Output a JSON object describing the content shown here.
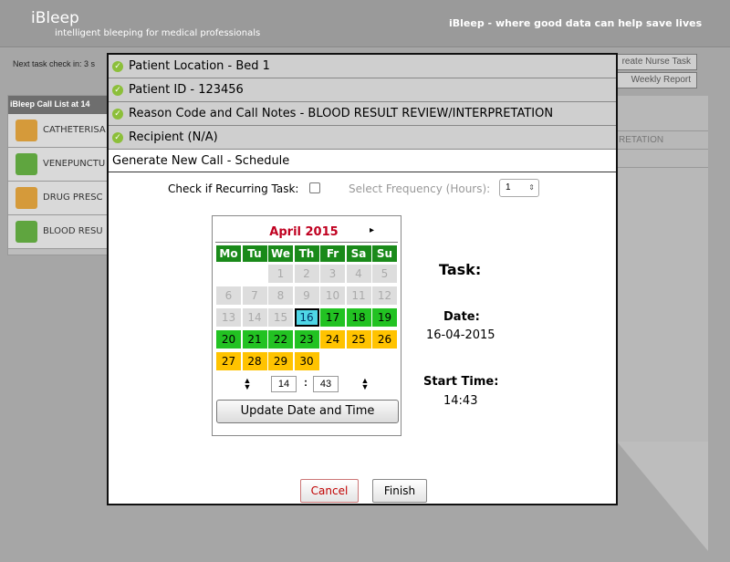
{
  "header": {
    "brand": "iBleep",
    "tagline": "intelligent bleeping for medical professionals",
    "slogan": "iBleep - where good data can help save lives"
  },
  "background": {
    "next_check": "Next task check in: 3 s",
    "create_nurse_task": "reate Nurse Task",
    "weekly_report": "Weekly Report",
    "call_list_title": "iBleep Call List at 14",
    "call_items": [
      {
        "label": "CATHETERISA",
        "icon": "rss-icon"
      },
      {
        "label": "VENEPUNCTU",
        "icon": "thumbs-up-icon"
      },
      {
        "label": "DRUG PRESC",
        "icon": "rss-icon"
      },
      {
        "label": "BLOOD RESU",
        "icon": "thumbs-up-icon"
      }
    ],
    "right_text": "RETATION"
  },
  "modal": {
    "accordion": [
      {
        "label": "Patient Location - Bed 1"
      },
      {
        "label": "Patient ID - 123456"
      },
      {
        "label": "Reason Code and Call Notes - BLOOD RESULT REVIEW/INTERPRETATION"
      },
      {
        "label": "Recipient (N/A)"
      }
    ],
    "section_title": "Generate New Call - Schedule",
    "recurring_label": "Check if Recurring Task:",
    "frequency_label": "Select Frequency (Hours):",
    "frequency_value": "1",
    "calendar": {
      "month": "April 2015",
      "next": "▸",
      "dow": [
        "Mo",
        "Tu",
        "We",
        "Th",
        "Fr",
        "Sa",
        "Su"
      ],
      "rows": [
        [
          null,
          null,
          {
            "d": "1",
            "s": "past"
          },
          {
            "d": "2",
            "s": "past"
          },
          {
            "d": "3",
            "s": "past"
          },
          {
            "d": "4",
            "s": "past"
          },
          {
            "d": "5",
            "s": "past"
          }
        ],
        [
          {
            "d": "6",
            "s": "past"
          },
          {
            "d": "7",
            "s": "past"
          },
          {
            "d": "8",
            "s": "past"
          },
          {
            "d": "9",
            "s": "past"
          },
          {
            "d": "10",
            "s": "past"
          },
          {
            "d": "11",
            "s": "past"
          },
          {
            "d": "12",
            "s": "past"
          }
        ],
        [
          {
            "d": "13",
            "s": "past"
          },
          {
            "d": "14",
            "s": "past"
          },
          {
            "d": "15",
            "s": "past"
          },
          {
            "d": "16",
            "s": "today"
          },
          {
            "d": "17",
            "s": "green"
          },
          {
            "d": "18",
            "s": "green"
          },
          {
            "d": "19",
            "s": "green"
          }
        ],
        [
          {
            "d": "20",
            "s": "green"
          },
          {
            "d": "21",
            "s": "green"
          },
          {
            "d": "22",
            "s": "green"
          },
          {
            "d": "23",
            "s": "green"
          },
          {
            "d": "24",
            "s": "yellow"
          },
          {
            "d": "25",
            "s": "yellow"
          },
          {
            "d": "26",
            "s": "yellow"
          }
        ],
        [
          {
            "d": "27",
            "s": "yellow"
          },
          {
            "d": "28",
            "s": "yellow"
          },
          {
            "d": "29",
            "s": "yellow"
          },
          {
            "d": "30",
            "s": "yellow"
          },
          null,
          null,
          null
        ]
      ]
    },
    "hour": "14",
    "minute": "43",
    "colon": ":",
    "update_btn": "Update Date and Time",
    "task_label": "Task:",
    "date_label": "Date:",
    "date_value": "16-04-2015",
    "start_time_label": "Start Time:",
    "start_time_value": "14:43",
    "cancel": "Cancel",
    "finish": "Finish"
  },
  "colors": {
    "accent_green": "#1a8a1a",
    "available": "#22c222",
    "later": "#ffc300",
    "today": "#4fd6e6",
    "month": "#c00020"
  }
}
